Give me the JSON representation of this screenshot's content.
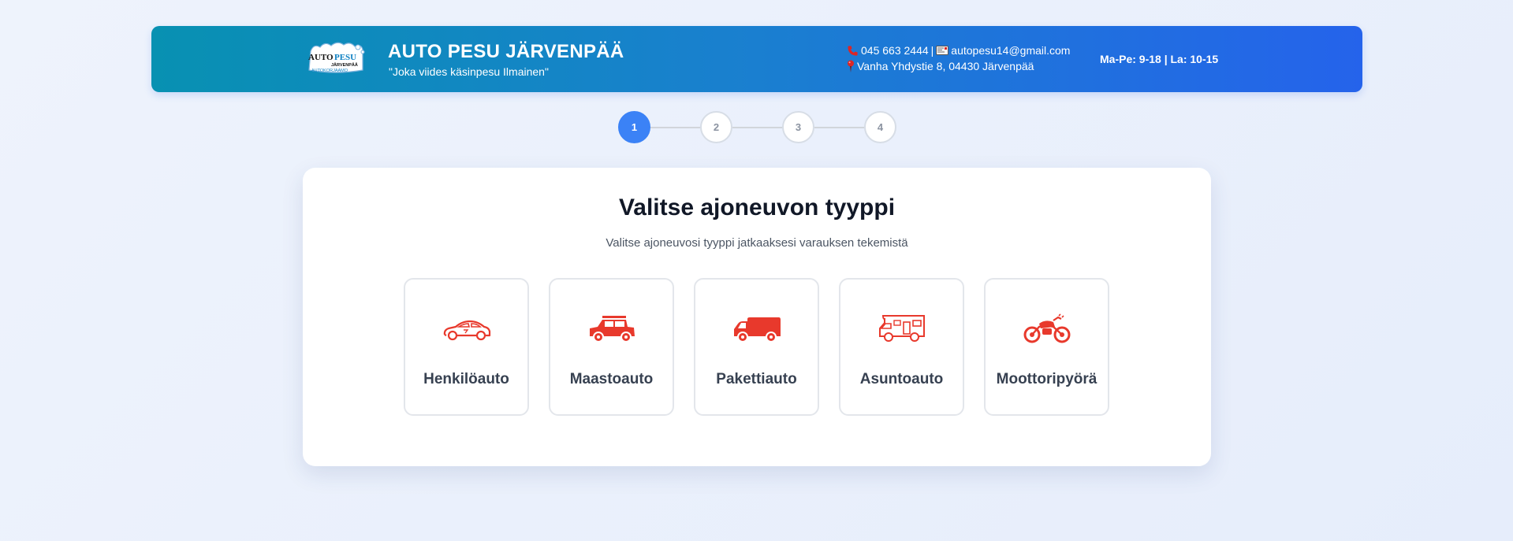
{
  "header": {
    "logo": {
      "line1": "AUTO",
      "line2": "PESU",
      "line3": "JÄRVENPÄÄ",
      "line4": "AUTOKORJAAMO"
    },
    "title": "AUTO PESU JÄRVENPÄÄ",
    "slogan": "\"Joka viides käsinpesu Ilmainen\"",
    "phone": "045 663 2444",
    "separator": "|",
    "email": "autopesu14@gmail.com",
    "address": "Vanha Yhdystie 8, 04430 Järvenpää",
    "hours": "Ma-Pe: 9-18 | La: 10-15",
    "icons": [
      "phone-icon",
      "email-icon",
      "location-pin-icon"
    ]
  },
  "stepper": {
    "steps": [
      "1",
      "2",
      "3",
      "4"
    ],
    "active": 1
  },
  "main": {
    "title": "Valitse ajoneuvon tyyppi",
    "subtitle": "Valitse ajoneuvosi tyyppi jatkaaksesi varauksen tekemistä",
    "vehicles": [
      {
        "label": "Henkilöauto",
        "icon": "car-icon"
      },
      {
        "label": "Maastoauto",
        "icon": "suv-icon"
      },
      {
        "label": "Pakettiauto",
        "icon": "van-icon"
      },
      {
        "label": "Asuntoauto",
        "icon": "motorhome-icon"
      },
      {
        "label": "Moottoripyörä",
        "icon": "motorcycle-icon"
      }
    ]
  },
  "colors": {
    "accent": "#3b82f6",
    "icon": "#e8392c",
    "header_start": "#0891b2",
    "header_end": "#2563eb"
  }
}
